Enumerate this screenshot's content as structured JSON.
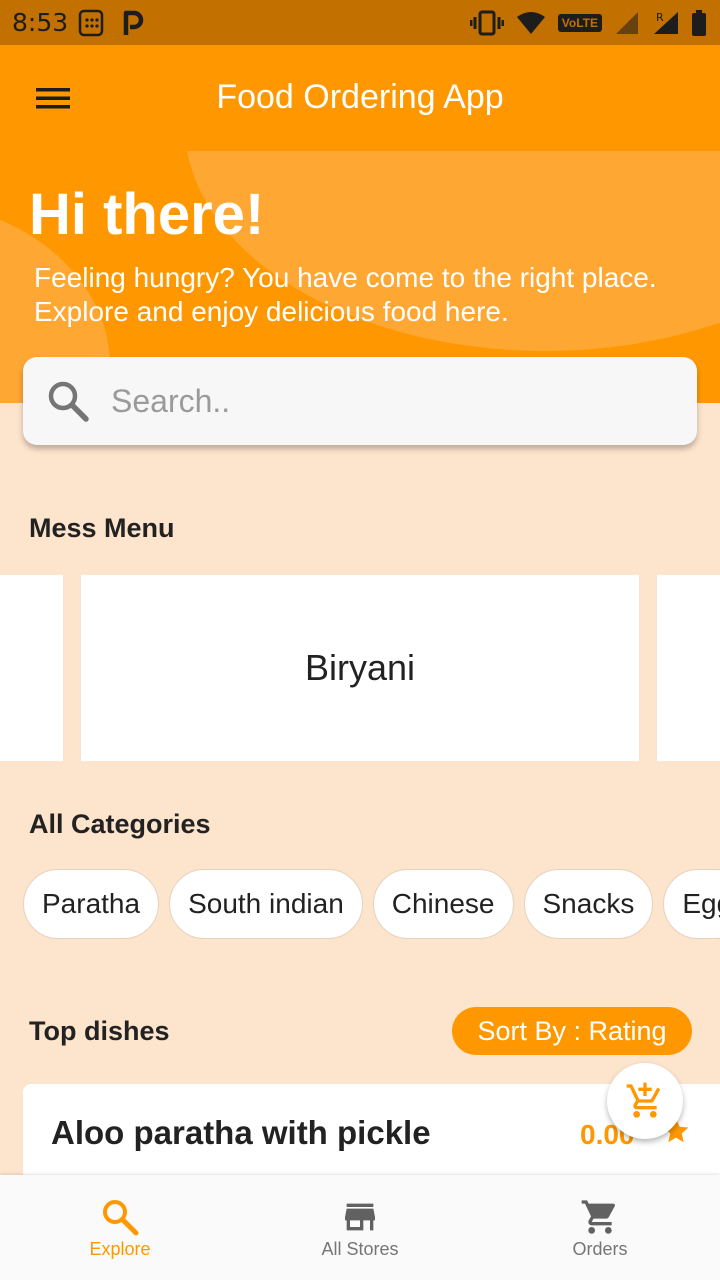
{
  "status_bar": {
    "time": "8:53",
    "network_badge": "VoLTE",
    "roaming": "R"
  },
  "app_bar": {
    "title": "Food Ordering App",
    "menu_icon": "hamburger-menu-icon"
  },
  "hero": {
    "title": "Hi there!",
    "subtitle": "Feeling hungry? You have come to the right place. Explore and enjoy delicious food here."
  },
  "search": {
    "placeholder": "Search..",
    "value": ""
  },
  "mess_menu": {
    "title": "Mess Menu",
    "items": [
      "Biryani"
    ]
  },
  "categories": {
    "title": "All Categories",
    "items": [
      "Paratha",
      "South indian",
      "Chinese",
      "Snacks",
      "Egg"
    ]
  },
  "top_dishes": {
    "title": "Top dishes",
    "sort_label": "Sort By : Rating",
    "dishes": [
      {
        "name": "Aloo paratha with pickle",
        "rating": "0.00"
      }
    ]
  },
  "bottom_nav": {
    "items": [
      {
        "label": "Explore",
        "icon": "search-icon",
        "active": true
      },
      {
        "label": "All Stores",
        "icon": "store-icon",
        "active": false
      },
      {
        "label": "Orders",
        "icon": "cart-icon",
        "active": false
      }
    ]
  },
  "colors": {
    "primary": "#ff9800",
    "background": "#fde4cc",
    "status_bar": "#c27000"
  }
}
